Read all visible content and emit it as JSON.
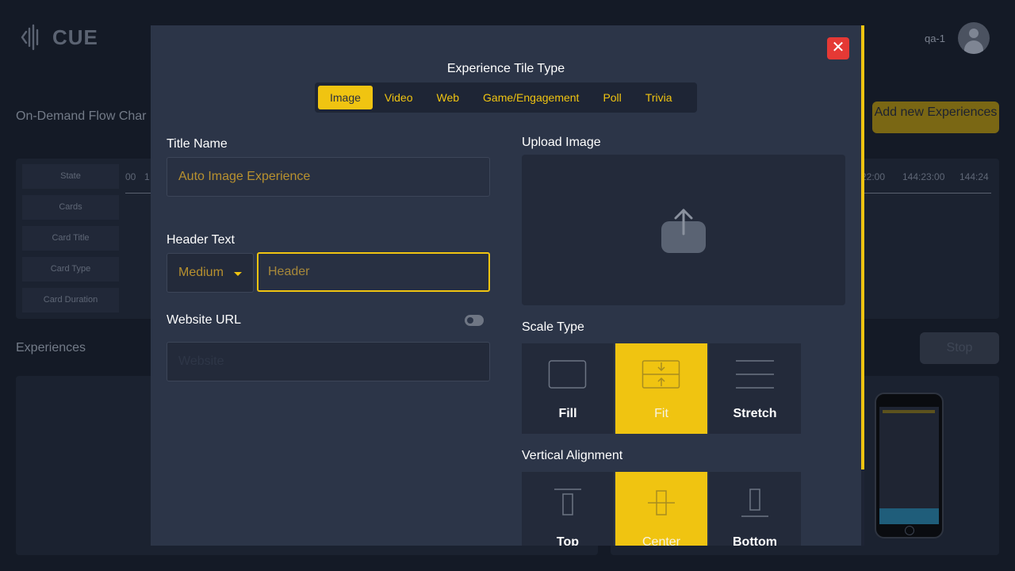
{
  "app": {
    "logo_text": "CUE",
    "user_name": "qa-1"
  },
  "background": {
    "flow_title": "On-Demand Flow Char",
    "add_button": "Add new Experiences",
    "flow_labels": [
      "State",
      "Cards",
      "Card Title",
      "Card Type",
      "Card Duration"
    ],
    "timeline_ticks": [
      "00",
      "1",
      "22:00",
      "144:23:00",
      "144:24"
    ],
    "experiences_title": "Experiences",
    "stop_button": "Stop"
  },
  "modal": {
    "title": "Experience Tile Type",
    "close_label": "✕",
    "tabs": [
      {
        "label": "Image",
        "active": true
      },
      {
        "label": "Video",
        "active": false
      },
      {
        "label": "Web",
        "active": false
      },
      {
        "label": "Game/Engagement",
        "active": false
      },
      {
        "label": "Poll",
        "active": false
      },
      {
        "label": "Trivia",
        "active": false
      }
    ],
    "title_name": {
      "label": "Title Name",
      "value": "Auto Image Experience"
    },
    "header_text": {
      "label": "Header Text",
      "size_value": "Medium",
      "placeholder": "Header"
    },
    "website_url": {
      "label": "Website URL",
      "placeholder": "Website",
      "toggle_on": false
    },
    "upload_image": {
      "label": "Upload Image"
    },
    "scale_type": {
      "label": "Scale Type",
      "options": [
        {
          "label": "Fill",
          "icon": "fill-icon",
          "active": false
        },
        {
          "label": "Fit",
          "icon": "fit-icon",
          "active": true
        },
        {
          "label": "Stretch",
          "icon": "stretch-icon",
          "active": false
        }
      ]
    },
    "vertical_alignment": {
      "label": "Vertical Alignment",
      "options": [
        {
          "label": "Top",
          "icon": "align-top-icon",
          "active": false
        },
        {
          "label": "Center",
          "icon": "align-center-icon",
          "active": true
        },
        {
          "label": "Bottom",
          "icon": "align-bottom-icon",
          "active": false
        }
      ]
    }
  },
  "colors": {
    "accent": "#f0c411",
    "modal_bg": "#2c3548",
    "close_red": "#e53935"
  }
}
